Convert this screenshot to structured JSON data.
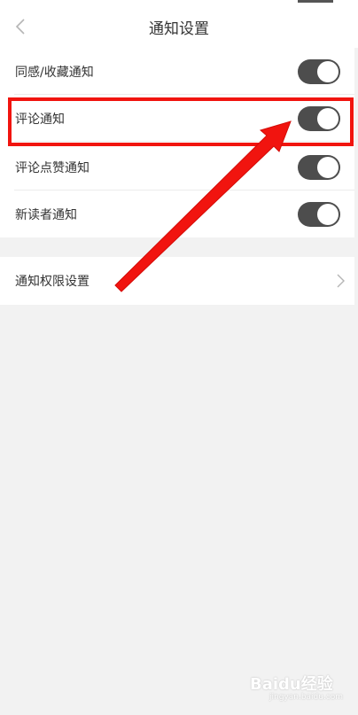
{
  "header": {
    "title": "通知设置",
    "back_icon": "chevron-left-icon"
  },
  "settings": {
    "items": [
      {
        "label": "同感/收藏通知",
        "enabled": true
      },
      {
        "label": "评论通知",
        "enabled": true
      },
      {
        "label": "评论点赞通知",
        "enabled": true
      },
      {
        "label": "新读者通知",
        "enabled": true
      }
    ],
    "permission": {
      "label": "通知权限设置",
      "icon": "chevron-right-icon"
    }
  },
  "colors": {
    "background": "#f2f2f2",
    "card": "#ffffff",
    "toggle_on": "#4d4d4d",
    "annotation": "#f1140f"
  },
  "watermark": {
    "logo_text": "Baidu经验",
    "url": "jingyan.baidu.com"
  }
}
